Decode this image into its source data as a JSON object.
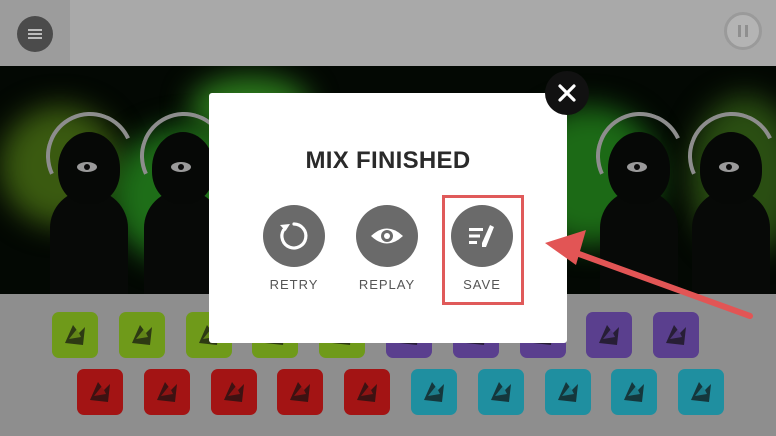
{
  "dialog": {
    "title": "MIX FINISHED",
    "actions": [
      {
        "id": "retry",
        "label": "RETRY",
        "icon": "retry-icon"
      },
      {
        "id": "replay",
        "label": "REPLAY",
        "icon": "eye-icon"
      },
      {
        "id": "save",
        "label": "SAVE",
        "icon": "edit-list-icon"
      }
    ]
  },
  "toolbar": {
    "menu_icon": "menu-icon",
    "pause_icon": "pause-icon",
    "close_icon": "close-icon"
  },
  "annotation": {
    "highlight_color": "#e05a5a"
  },
  "sound_tiles": {
    "row1_colors": [
      "#6f9a1a",
      "#6f9a1a",
      "#6f9a1a",
      "#6f9a1a",
      "#6f9a1a",
      "#5a3f8e",
      "#5a3f8e",
      "#5a3f8e",
      "#5a3f8e",
      "#5a3f8e"
    ],
    "row2_colors": [
      "#a31414",
      "#a31414",
      "#a31414",
      "#a31414",
      "#a31414",
      "#1f8fa0",
      "#1f8fa0",
      "#1f8fa0",
      "#1f8fa0",
      "#1f8fa0"
    ]
  }
}
